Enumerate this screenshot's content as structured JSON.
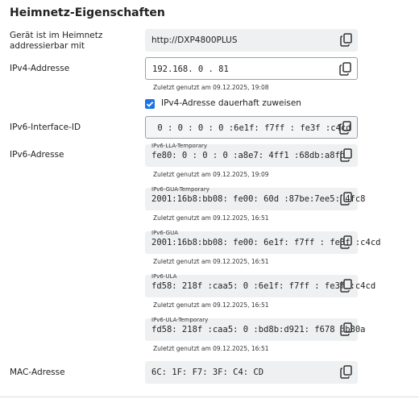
{
  "title": "Heimnetz-Eigenschaften",
  "address": {
    "label": "Gerät ist im Heimnetz addressierbar mit",
    "value": "http://DXP4800PLUS"
  },
  "ipv4": {
    "label": "IPv4-Addresse",
    "value": "192.168. 0 . 81",
    "last_used": "Zuletzt genutzt am 09.12.2025, 19:08"
  },
  "ipv4_permanent": {
    "label": "IPv4-Adresse dauerhaft zuweisen",
    "checked": true
  },
  "ipv6_interface": {
    "label": "IPv6-Interface-ID",
    "value": " 0 : 0 : 0 : 0 :6e1f: f7ff : fe3f :c4cd"
  },
  "ipv6": {
    "label": "IPv6-Adresse",
    "entries": [
      {
        "tag": "IPv6-LLA-Temporary",
        "value": "fe80: 0 : 0 : 0 :a8e7: 4ff1 :68db:a8fd",
        "last_used": "Zuletzt genutzt am 09.12.2025, 19:09"
      },
      {
        "tag": "IPv6-GUA-Temporary",
        "value": "2001:16b8:bb08: fe00: 60d :87be:7ee5: 4fc8",
        "last_used": "Zuletzt genutzt am 09.12.2025, 16:51"
      },
      {
        "tag": "IPv6-GUA",
        "value": "2001:16b8:bb08: fe00: 6e1f: f7ff : fe3f :c4cd",
        "last_used": "Zuletzt genutzt am 09.12.2025, 16:51"
      },
      {
        "tag": "IPv6-ULA",
        "value": "fd58: 218f :caa5: 0 :6e1f: f7ff : fe3f :c4cd",
        "last_used": "Zuletzt genutzt am 09.12.2025, 16:51"
      },
      {
        "tag": "IPv6-ULA-Temporary",
        "value": "fd58: 218f :caa5: 0 :bd8b:d921: f678 :b80a",
        "last_used": "Zuletzt genutzt am 09.12.2025, 16:51"
      }
    ]
  },
  "mac": {
    "label": "MAC-Adresse",
    "value": "6C: 1F: F7: 3F: C4: CD"
  },
  "icons": {
    "copy": "copy-icon",
    "checkbox": "checkmark-icon"
  },
  "colors": {
    "accent": "#1a73e8",
    "field_bg": "#eef0f1"
  }
}
